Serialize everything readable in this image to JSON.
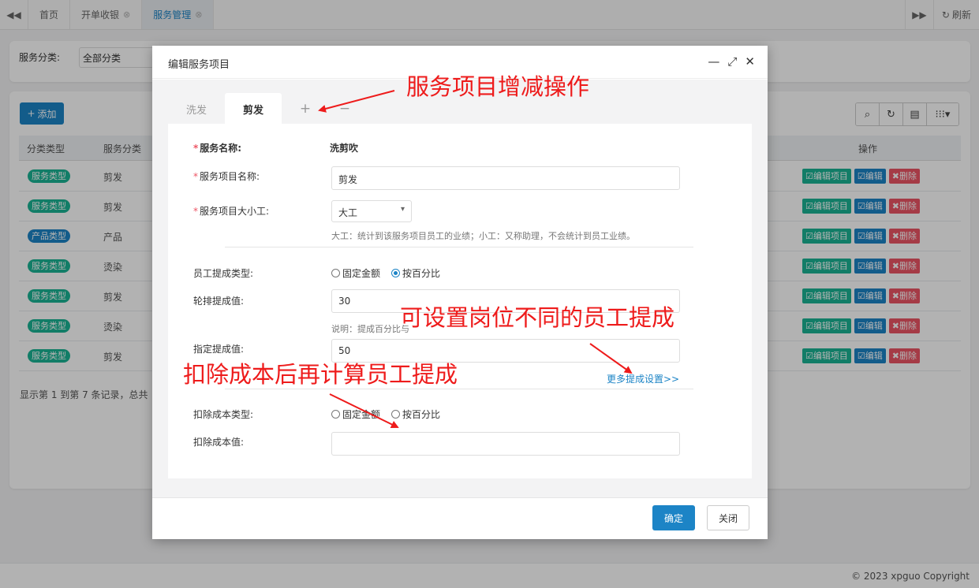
{
  "topbar": {
    "left_nav_icon": "double-chevron-left-icon",
    "tabs": [
      {
        "label": "首页",
        "closable": false
      },
      {
        "label": "开单收银",
        "closable": true
      },
      {
        "label": "服务管理",
        "closable": true,
        "active": true
      }
    ],
    "right_nav_icon": "double-chevron-right-icon",
    "refresh_label": "刷新"
  },
  "filter": {
    "label": "服务分类:",
    "value": "全部分类"
  },
  "toolbar": {
    "add_label": "添加"
  },
  "table": {
    "headers": [
      "分类类型",
      "服务分类",
      "操作"
    ],
    "rows": [
      {
        "type": "服务类型",
        "cat": "剪发"
      },
      {
        "type": "服务类型",
        "cat": "剪发"
      },
      {
        "type": "产品类型",
        "cat": "产品"
      },
      {
        "type": "服务类型",
        "cat": "烫染"
      },
      {
        "type": "服务类型",
        "cat": "剪发"
      },
      {
        "type": "服务类型",
        "cat": "烫染"
      },
      {
        "type": "服务类型",
        "cat": "剪发"
      }
    ],
    "ops": {
      "edit_item": "编辑项目",
      "edit": "编辑",
      "delete": "删除"
    }
  },
  "pager": "显示第 1 到第 7 条记录，总共",
  "footer": "© 2023 xpguo Copyright",
  "modal": {
    "title": "编辑服务项目",
    "tabs": [
      {
        "label": "洗发",
        "active": false
      },
      {
        "label": "剪发",
        "active": true
      }
    ],
    "add_symbol": "+",
    "remove_symbol": "−",
    "fields": {
      "service_name_label": "服务名称:",
      "service_name_value": "洗剪吹",
      "item_name_label": "服务项目名称:",
      "item_name_value": "剪发",
      "worker_size_label": "服务项目大小工:",
      "worker_size_value": "大工",
      "worker_size_help": "大工：统计到该服务项目员工的业绩；小工：又称助理，不会统计到员工业绩。",
      "commission_type_label": "员工提成类型:",
      "commission_fixed": "固定金额",
      "commission_percent": "按百分比",
      "rotation_label": "轮排提成值:",
      "rotation_value": "30",
      "rotation_help": "说明：提成百分比与",
      "designated_label": "指定提成值:",
      "designated_value": "50",
      "more_link": "更多提成设置>>",
      "cost_type_label": "扣除成本类型:",
      "cost_fixed": "固定金额",
      "cost_percent": "按百分比",
      "cost_value_label": "扣除成本值:",
      "cost_value": ""
    },
    "ok_label": "确定",
    "close_label": "关闭"
  },
  "annotations": {
    "a1": "服务项目增减操作",
    "a2": "可设置岗位不同的员工提成",
    "a3": "扣除成本后再计算员工提成"
  },
  "colors": {
    "primary": "#1c84c6",
    "green": "#1ab394",
    "red": "#ed5565",
    "annotation": "#ee1b1b"
  }
}
